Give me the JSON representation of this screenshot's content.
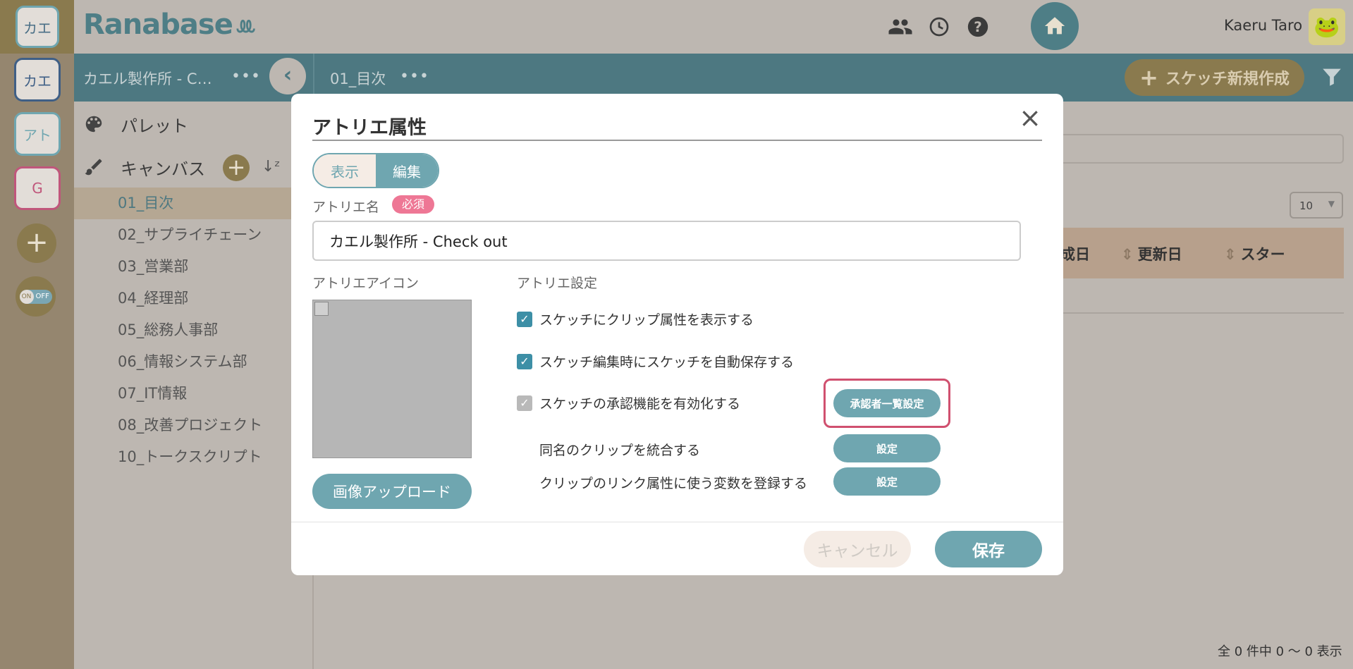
{
  "colors": {
    "teal": "#6fa6b0",
    "dark_teal": "#4d7881",
    "olive": "#8a7a4e",
    "pink": "#ee7795",
    "highlight": "#d0506f"
  },
  "rail": {
    "top_workspace": "カエ",
    "workspaces": [
      {
        "label": "カエ",
        "color": "#3f5f86"
      },
      {
        "label": "アト",
        "color": "#6fa6b0"
      },
      {
        "label": "G",
        "color": "#c0567b"
      }
    ],
    "add": "+",
    "toggle_on": "ON",
    "toggle_off": "OFF"
  },
  "header": {
    "logo": "Ranabase",
    "user_name": "Kaeru Taro",
    "icons": [
      "home-icon",
      "people-icon",
      "history-icon",
      "help-icon"
    ]
  },
  "subbar": {
    "atelier_name": "カエル製作所 - C…",
    "more": "•••",
    "collapse": "‹",
    "canvas_title": "01_目次",
    "new_sketch": "スケッチ新規作成",
    "new_sketch_plus": "+"
  },
  "sidebar": {
    "palette": "パレット",
    "canvas": "キャンバス",
    "add": "+",
    "sort": "↓ᶻ",
    "items": [
      "01_目次",
      "02_サプライチェーン",
      "03_営業部",
      "04_経理部",
      "05_総務人事部",
      "06_情報システム部",
      "07_IT情報",
      "08_改善プロジェクト",
      "10_トークスクリプト"
    ]
  },
  "main": {
    "per_page": "10",
    "columns": [
      "成日",
      "更新日",
      "スター"
    ],
    "footer": "全 0 件中 0 〜 0 表示"
  },
  "modal": {
    "title": "アトリエ属性",
    "close": "×",
    "tabs": {
      "view": "表示",
      "edit": "編集"
    },
    "name_label": "アトリエ名",
    "required": "必須",
    "name_value": "カエル製作所 - Check out",
    "icon_label": "アトリエアイコン",
    "upload": "画像アップロード",
    "settings_label": "アトリエ設定",
    "options": [
      {
        "label": "スケッチにクリップ属性を表示する",
        "checked": true
      },
      {
        "label": "スケッチ編集時にスケッチを自動保存する",
        "checked": true
      },
      {
        "label": "スケッチの承認機能を有効化する",
        "checked": true
      }
    ],
    "approver_button": "承認者一覧設定",
    "merge_label": "同名のクリップを統合する",
    "merge_button": "設定",
    "variables_label": "クリップのリンク属性に使う変数を登録する",
    "variables_button": "設定",
    "cancel": "キャンセル",
    "save": "保存"
  }
}
